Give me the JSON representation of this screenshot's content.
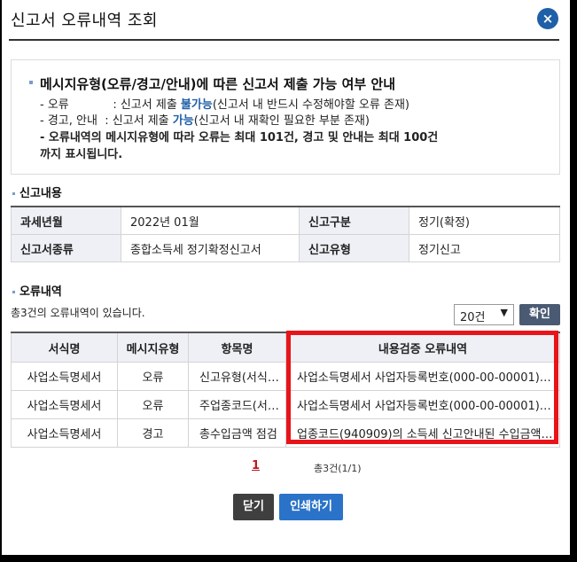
{
  "dialog": {
    "title": "신고서 오류내역 조회",
    "close_icon": "×"
  },
  "notice": {
    "heading": "메시지유형(오류/경고/안내)에 따른 신고서 제출 가능 여부 안내",
    "line1_prefix": "- 오류            : 신고서 제출 ",
    "line1_highlight": "불가능",
    "line1_suffix": "(신고서 내 반드시 수정해야할 오류 존재)",
    "line2_prefix": "- 경고, 안내  : 신고서 제출 ",
    "line2_highlight": "가능",
    "line2_suffix": "(신고서 내 재확인 필요한 부분 존재)",
    "line3": "- 오류내역의 메시지유형에 따라 오류는 최대 101건, 경고 및 안내는 최대 100건",
    "line4": "까지 표시됩니다."
  },
  "report_section": {
    "heading": "신고내용",
    "rows": [
      {
        "label1": "과세년월",
        "value1": "2022년 01월",
        "label2": "신고구분",
        "value2": "정기(확정)"
      },
      {
        "label1": "신고서종류",
        "value1": "종합소득세 정기확정신고서",
        "label2": "신고유형",
        "value2": "정기신고"
      }
    ]
  },
  "error_section": {
    "heading": "오류내역",
    "count_text": "총3건의 오류내역이 있습니다.",
    "page_size": "20건",
    "confirm_label": "확인",
    "columns": [
      "서식명",
      "메시지유형",
      "항목명",
      "내용검증 오류내역"
    ],
    "rows": [
      {
        "form": "사업소득명세서",
        "type": "오류",
        "item": "신고유형(서식)…",
        "detail": "사업소득명세서 사업자등록번호(000-00-00001)…"
      },
      {
        "form": "사업소득명세서",
        "type": "오류",
        "item": "주업종코드(서식…",
        "detail": "사업소득명세서 사업자등록번호(000-00-00001)…"
      },
      {
        "form": "사업소득명세서",
        "type": "경고",
        "item": "총수입금액 점검",
        "detail": "업종코드(940909)의 소득세 신고안내된 수입금액…"
      }
    ]
  },
  "pager": {
    "current_page": "1",
    "total": "총3건(1/1)"
  },
  "buttons": {
    "close_label": "닫기",
    "print_label": "인쇄하기"
  },
  "colors": {
    "accent_blue": "#1f5fa8",
    "highlight_red": "#e8141a",
    "header_bg": "#eef0f5"
  }
}
